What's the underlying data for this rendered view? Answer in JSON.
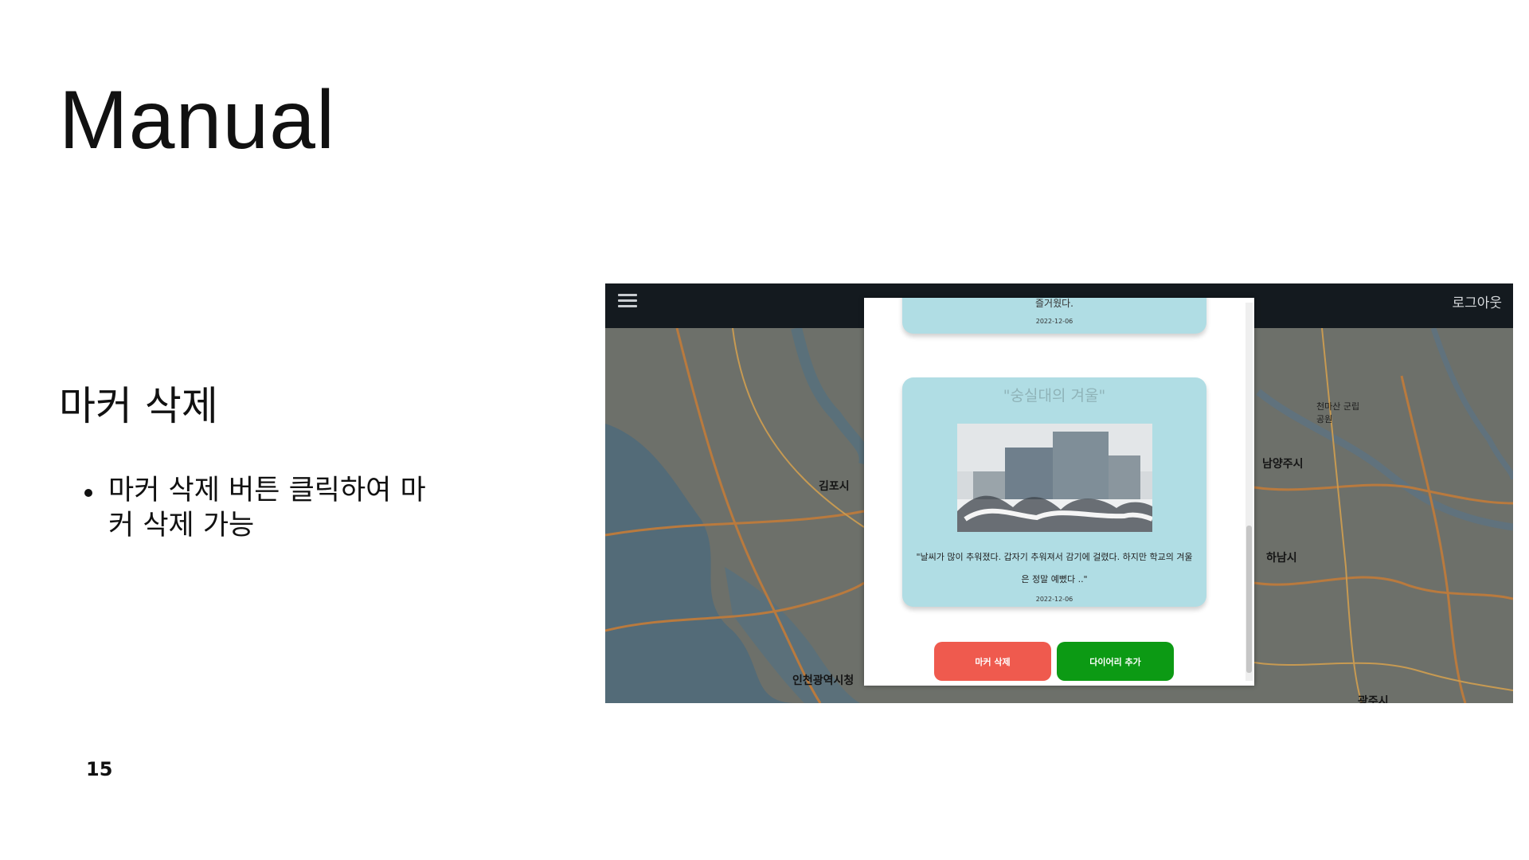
{
  "slide": {
    "title": "Manual",
    "section_heading": "마커 삭제",
    "bullets": [
      "마커 삭제 버튼 클릭하여 마커 삭제 가능"
    ],
    "page_number": "15"
  },
  "app": {
    "topbar": {
      "logout_label": "로그아웃"
    },
    "map": {
      "labels": [
        "김포시",
        "인천광역시청",
        "남양주시",
        "하남시",
        "광주시",
        "천마산 군립공원"
      ]
    },
    "modal": {
      "prev_card": {
        "text": "즐거웠다.",
        "date": "2022-12-06"
      },
      "card": {
        "title": "\"숭실대의 겨울\"",
        "body": "\"날씨가 많이 추워졌다. 갑자기 추워져서 감기에 걸렸다. 하지만 학교의 겨울은 정말 예뻤다 ..\"",
        "date": "2022-12-06"
      },
      "delete_button": "마커 삭제",
      "add_button": "다이어리 추가"
    }
  },
  "colors": {
    "topbar": "#141a1f",
    "card_bg": "#b0dde4",
    "delete_button": "#ef5a4e",
    "add_button": "#0c9a14"
  }
}
